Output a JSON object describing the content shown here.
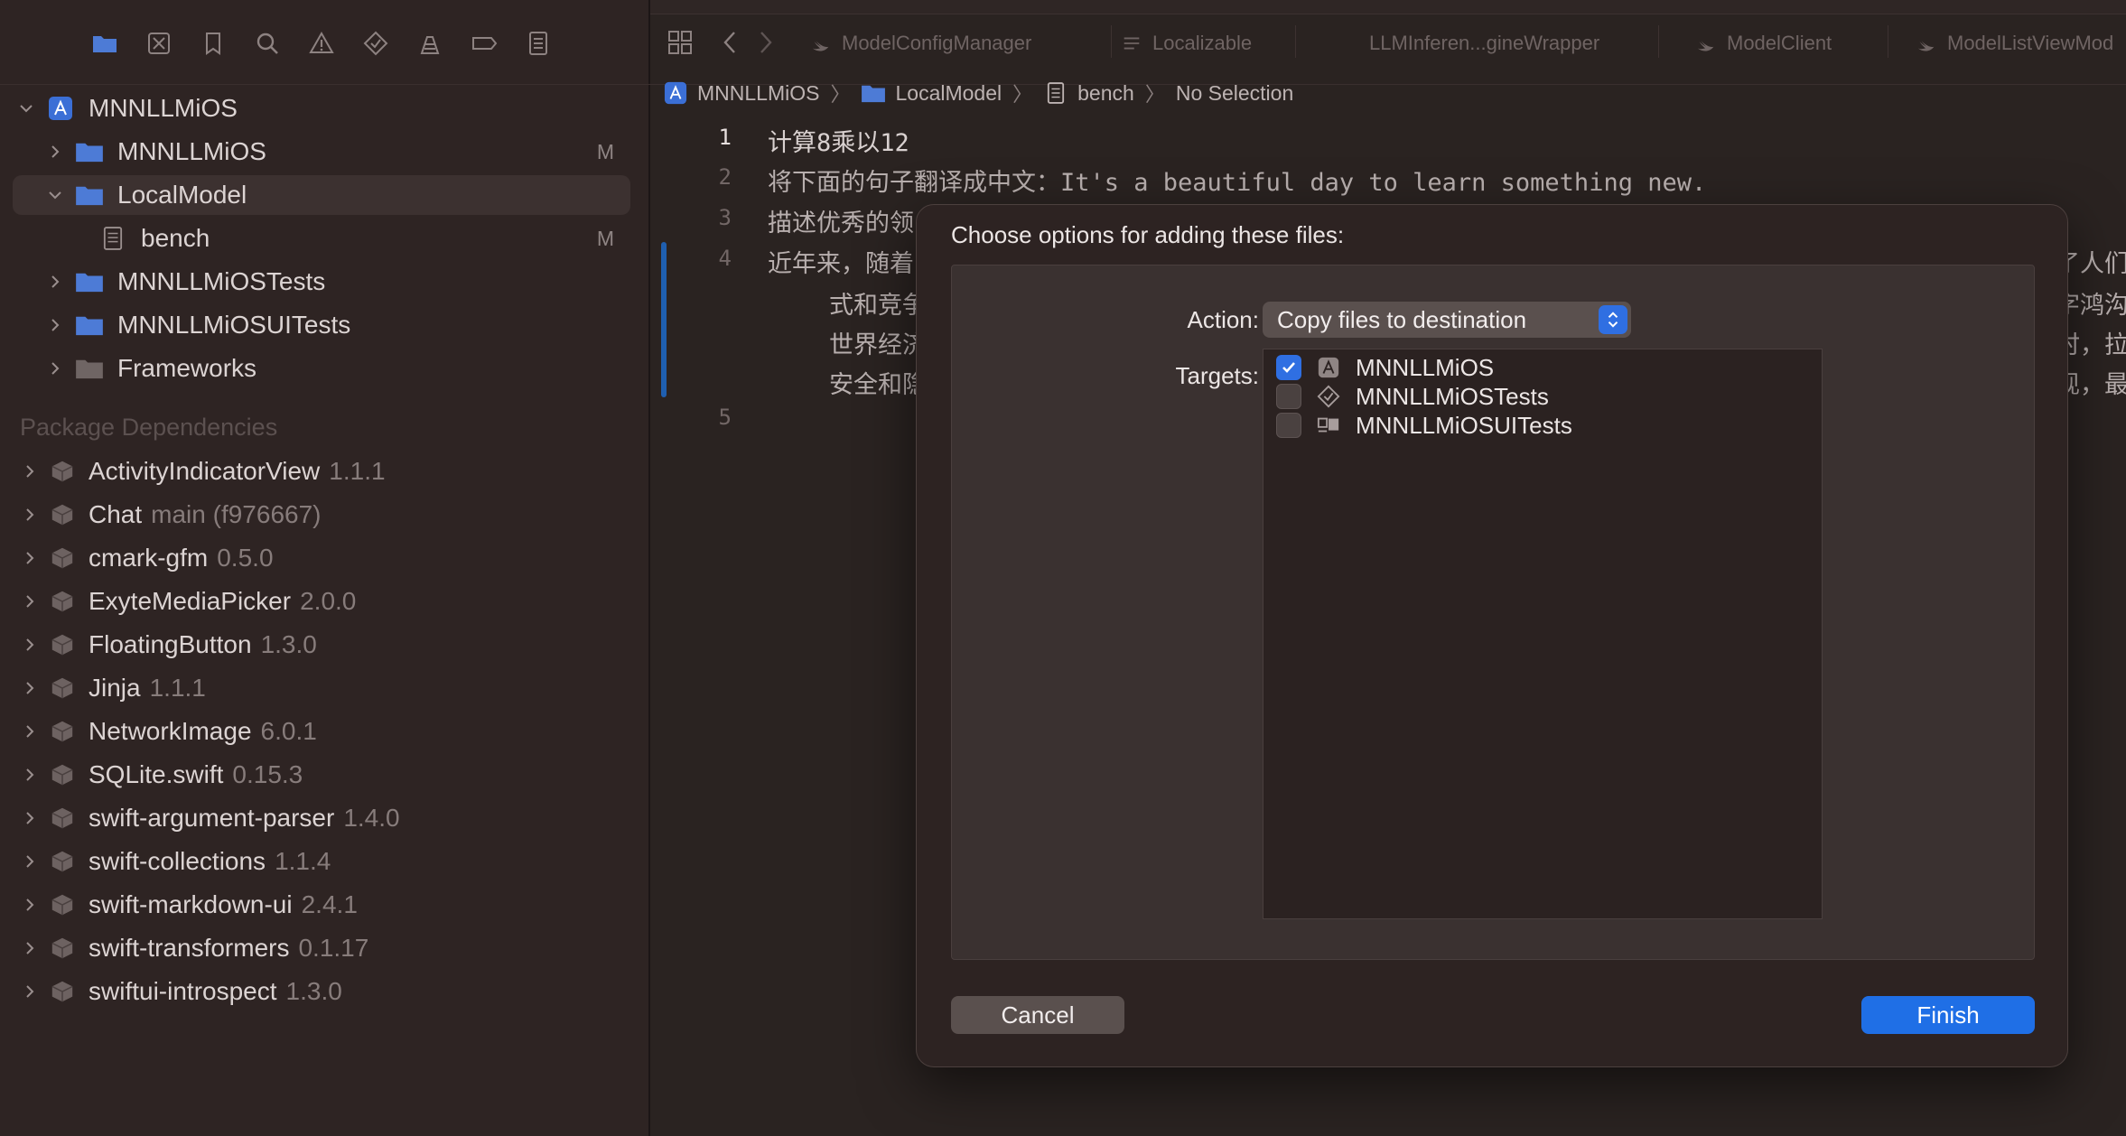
{
  "navigator": {
    "toolbar_icons": [
      "folder-icon",
      "source-control-icon",
      "bookmark-icon",
      "find-icon",
      "issue-icon",
      "test-icon",
      "debug-icon",
      "breakpoint-icon",
      "report-icon"
    ],
    "project": {
      "name": "MNNLLMiOS"
    },
    "items": [
      {
        "label": "MNNLLMiOS",
        "status": "M"
      },
      {
        "label": "LocalModel",
        "status": ""
      },
      {
        "label": "bench",
        "status": "M"
      },
      {
        "label": "MNNLLMiOSTests",
        "status": ""
      },
      {
        "label": "MNNLLMiOSUITests",
        "status": ""
      },
      {
        "label": "Frameworks",
        "status": ""
      }
    ],
    "package_section_title": "Package Dependencies",
    "packages": [
      {
        "name": "ActivityIndicatorView",
        "version": "1.1.1"
      },
      {
        "name": "Chat",
        "version": "main (f976667)"
      },
      {
        "name": "cmark-gfm",
        "version": "0.5.0"
      },
      {
        "name": "ExyteMediaPicker",
        "version": "2.0.0"
      },
      {
        "name": "FloatingButton",
        "version": "1.3.0"
      },
      {
        "name": "Jinja",
        "version": "1.1.1"
      },
      {
        "name": "NetworkImage",
        "version": "6.0.1"
      },
      {
        "name": "SQLite.swift",
        "version": "0.15.3"
      },
      {
        "name": "swift-argument-parser",
        "version": "1.4.0"
      },
      {
        "name": "swift-collections",
        "version": "1.1.4"
      },
      {
        "name": "swift-markdown-ui",
        "version": "2.4.1"
      },
      {
        "name": "swift-transformers",
        "version": "0.1.17"
      },
      {
        "name": "swiftui-introspect",
        "version": "1.3.0"
      }
    ]
  },
  "editor": {
    "tabs": [
      "ModelConfigManager",
      "Localizable",
      "LLMInferen...gineWrapper",
      "ModelClient",
      "ModelListViewMod"
    ],
    "breadcrumb": [
      "MNNLLMiOS",
      "LocalModel",
      "bench",
      "No Selection"
    ],
    "lines": [
      {
        "num": "1",
        "text": "计算8乘以12"
      },
      {
        "num": "2",
        "text": "将下面的句子翻译成中文：It's a beautiful day to learn something new."
      },
      {
        "num": "3",
        "text": "描述优秀的领"
      },
      {
        "num": "4",
        "text": "近年来，随着"
      },
      {
        "num": "",
        "text": "式和竞争"
      },
      {
        "num": "",
        "text": "世界经济"
      },
      {
        "num": "",
        "text": "安全和隐"
      },
      {
        "num": "5",
        "text": ""
      }
    ],
    "right_fragments": [
      "了人们",
      "字鸿沟",
      "时，拉",
      "现，最"
    ]
  },
  "dialog": {
    "title": "Choose options for adding these files:",
    "action_label": "Action:",
    "action_value": "Copy files to destination",
    "targets_label": "Targets:",
    "targets": [
      {
        "name": "MNNLLMiOS",
        "checked": true
      },
      {
        "name": "MNNLLMiOSTests",
        "checked": false
      },
      {
        "name": "MNNLLMiOSUITests",
        "checked": false
      }
    ],
    "cancel_label": "Cancel",
    "finish_label": "Finish"
  },
  "colors": {
    "accent": "#1f6fe6",
    "background": "#2b2222",
    "folder": "#4d7bd6"
  }
}
